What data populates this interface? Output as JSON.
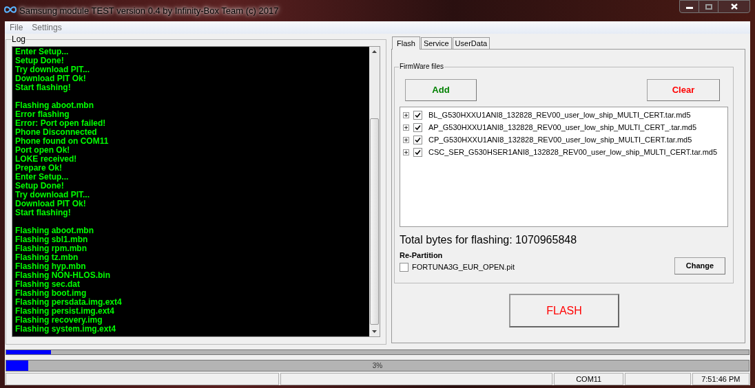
{
  "window": {
    "title": "Samsung module TEST version 0.4 by Infinity-Box Team (c) 2017"
  },
  "menu": [
    "File",
    "Settings"
  ],
  "log": {
    "title": "Log",
    "blocks": [
      [
        "Enter Setup...",
        "Setup Done!",
        "Try download PIT...",
        "Download PIT Ok!",
        "Start flashing!"
      ],
      [
        "Flashing aboot.mbn",
        "Error flashing",
        "Error: Port open failed!",
        "Phone Disconnected",
        "Phone found on COM11",
        "Port open Ok!",
        "LOKE received!",
        "Prepare Ok!",
        "Enter Setup...",
        "Setup Done!",
        "Try download PIT...",
        "Download PIT Ok!",
        "Start flashing!"
      ],
      [
        "Flashing aboot.mbn",
        "Flashing sbl1.mbn",
        "Flashing rpm.mbn",
        "Flashing tz.mbn",
        "Flashing hyp.mbn",
        "Flashing NON-HLOS.bin",
        "Flashing sec.dat",
        "Flashing boot.img",
        "Flashing persdata.img.ext4",
        "Flashing persist.img.ext4",
        "Flashing recovery.img",
        "Flashing system.img.ext4"
      ]
    ]
  },
  "tabs": [
    {
      "label": "Flash",
      "selected": true
    },
    {
      "label": "Service",
      "selected": false
    },
    {
      "label": "UserData",
      "selected": false
    }
  ],
  "firmware": {
    "title": "FirmWare files",
    "add_button": "Add",
    "clear_button": "Clear",
    "files": [
      {
        "name": "BL_G530HXXU1ANI8_132828_REV00_user_low_ship_MULTI_CERT.tar.md5",
        "checked": true
      },
      {
        "name": "AP_G530HXXU1ANI8_132828_REV00_user_low_ship_MULTI_CERT_.tar.md5",
        "checked": true
      },
      {
        "name": "CP_G530HXXU1ANI8_132828_REV00_user_low_ship_MULTI_CERT.tar.md5",
        "checked": true
      },
      {
        "name": "CSC_SER_G530HSER1ANI8_132828_REV00_user_low_ship_MULTI_CERT.tar.md5",
        "checked": true
      }
    ],
    "total": "Total bytes for flashing: 1070965848",
    "repartition": {
      "title": "Re-Partition",
      "file": "FORTUNA3G_EUR_OPEN.pit",
      "checked": false,
      "change_button": "Change"
    }
  },
  "flash_button": "FLASH",
  "progress_top": {
    "level": 0.06
  },
  "progress_main": {
    "level": 0.03,
    "label": "3%"
  },
  "status_bar": {
    "port": "COM11",
    "time": "7:51:46 PM"
  }
}
